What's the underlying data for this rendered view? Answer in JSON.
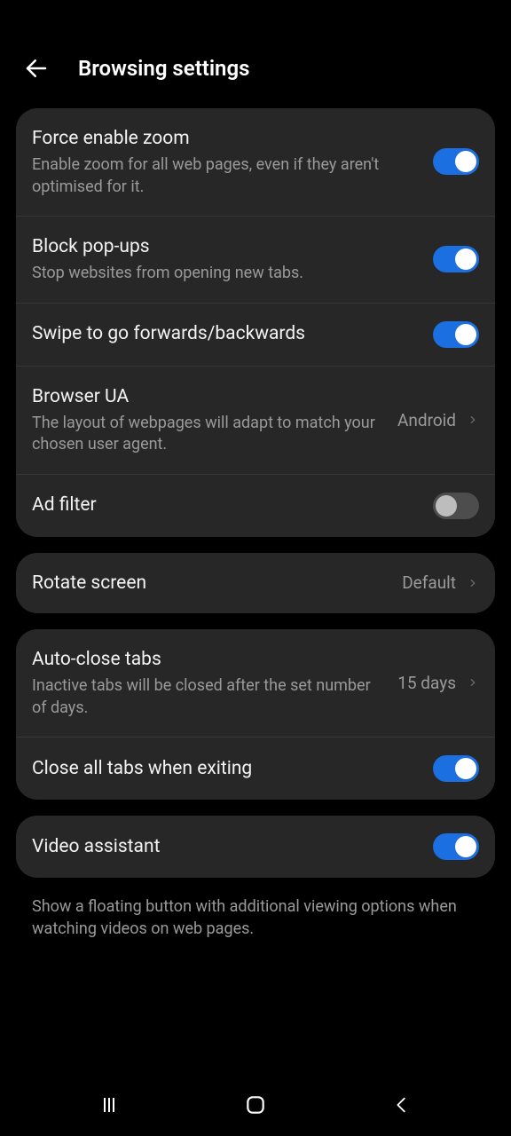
{
  "header": {
    "title": "Browsing settings"
  },
  "groups": [
    {
      "items": [
        {
          "key": "force-zoom",
          "title": "Force enable zoom",
          "sub": "Enable zoom for all web pages, even if they aren't optimised for it.",
          "toggle": true
        },
        {
          "key": "block-popups",
          "title": "Block pop-ups",
          "sub": "Stop websites from opening new tabs.",
          "toggle": true
        },
        {
          "key": "swipe-nav",
          "title": "Swipe to go forwards/backwards",
          "toggle": true
        },
        {
          "key": "browser-ua",
          "title": "Browser UA",
          "sub": "The layout of webpages will adapt to match your chosen user agent.",
          "value": "Android",
          "chevron": true
        },
        {
          "key": "ad-filter",
          "title": "Ad filter",
          "toggle": false
        }
      ]
    },
    {
      "items": [
        {
          "key": "rotate-screen",
          "title": "Rotate screen",
          "value": "Default",
          "chevron": true
        }
      ]
    },
    {
      "items": [
        {
          "key": "auto-close-tabs",
          "title": "Auto-close tabs",
          "sub": "Inactive tabs will be closed after the set number of days.",
          "value": "15 days",
          "chevron": true
        },
        {
          "key": "close-all-exit",
          "title": "Close all tabs when exiting",
          "toggle": true
        }
      ]
    },
    {
      "items": [
        {
          "key": "video-assistant",
          "title": "Video assistant",
          "toggle": true
        }
      ],
      "footer": "Show a floating button with additional viewing options when watching videos on web pages."
    }
  ]
}
